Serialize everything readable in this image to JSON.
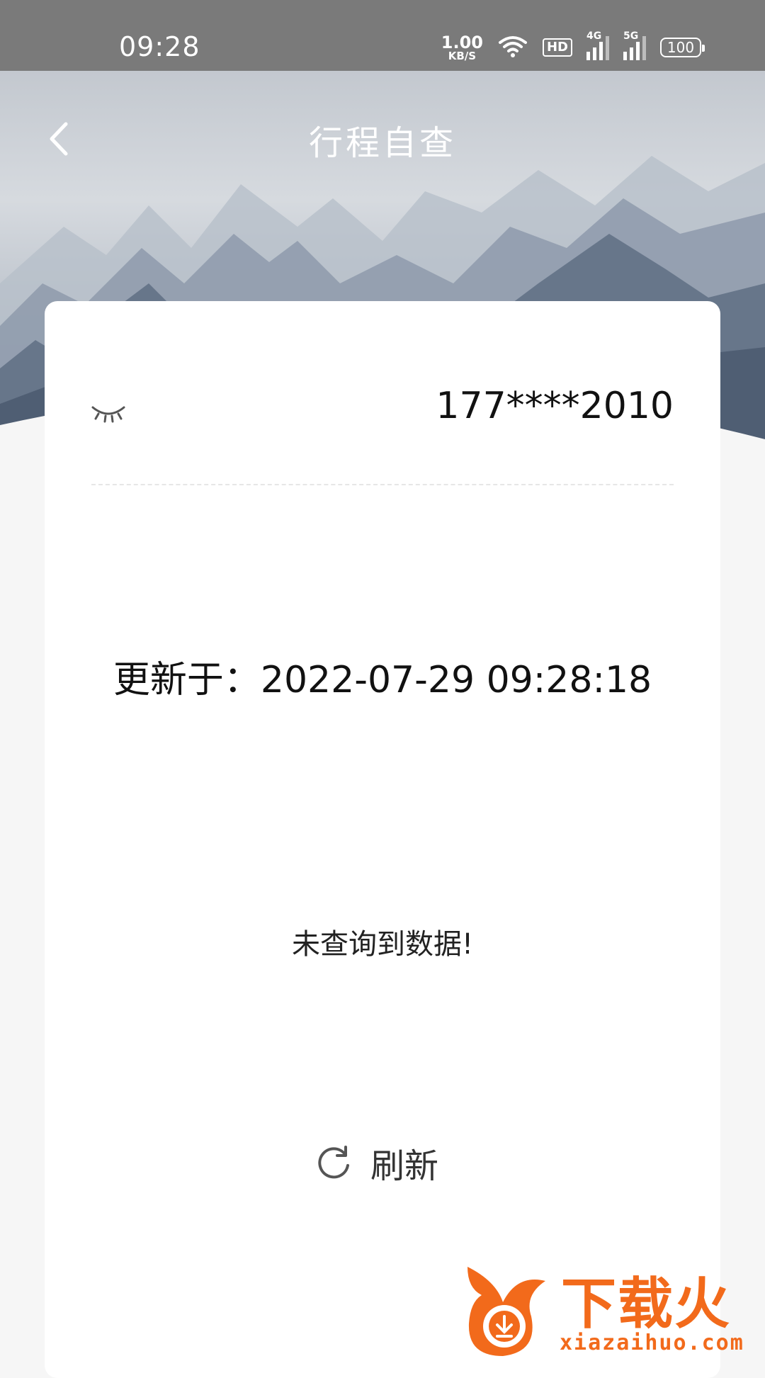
{
  "status_bar": {
    "time": "09:28",
    "net_speed_value": "1.00",
    "net_speed_unit": "KB/S",
    "hd_label": "HD",
    "signal_1_label": "4G",
    "signal_2_label": "5G",
    "battery": "100"
  },
  "header": {
    "title": "行程自查"
  },
  "card": {
    "phone": "177****2010",
    "update_label": "更新于：",
    "update_time": "2022-07-29 09:28:18",
    "empty_message": "未查询到数据!",
    "refresh_label": "刷新"
  },
  "watermark": {
    "brand": "下载火",
    "url": "xiazaihuo.com"
  },
  "colors": {
    "status_bar": "#7a7a7a",
    "card": "#ffffff",
    "page_bg": "#f6f6f6",
    "watermark": "#f26a1b"
  }
}
